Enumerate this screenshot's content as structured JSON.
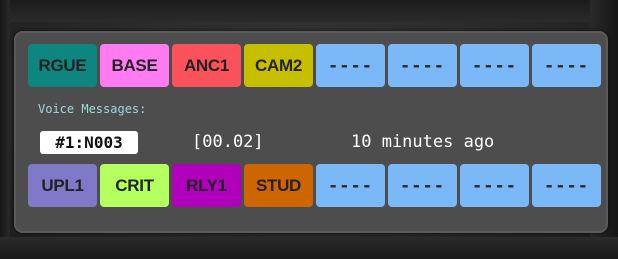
{
  "top_row": [
    {
      "label": "RGUE",
      "color": "#0e857e"
    },
    {
      "label": "BASE",
      "color": "#ff7bf2"
    },
    {
      "label": "ANC1",
      "color": "#f9525a"
    },
    {
      "label": "CAM2",
      "color": "#c6bf00"
    },
    {
      "label": "----",
      "color": "#7ab8f8"
    },
    {
      "label": "----",
      "color": "#7ab8f8"
    },
    {
      "label": "----",
      "color": "#7ab8f8"
    },
    {
      "label": "----",
      "color": "#7ab8f8"
    }
  ],
  "bottom_row": [
    {
      "label": "UPL1",
      "color": "#7f79c7"
    },
    {
      "label": "CRIT",
      "color": "#b5ff5e"
    },
    {
      "label": "RLY1",
      "color": "#b100bc"
    },
    {
      "label": "STUD",
      "color": "#cd6500"
    },
    {
      "label": "----",
      "color": "#7ab8f8"
    },
    {
      "label": "----",
      "color": "#7ab8f8"
    },
    {
      "label": "----",
      "color": "#7ab8f8"
    },
    {
      "label": "----",
      "color": "#7ab8f8"
    }
  ],
  "voice": {
    "label": "Voice Messages:",
    "message_id": "#1:N003",
    "duration": "[00.02]",
    "age": "10 minutes ago"
  }
}
